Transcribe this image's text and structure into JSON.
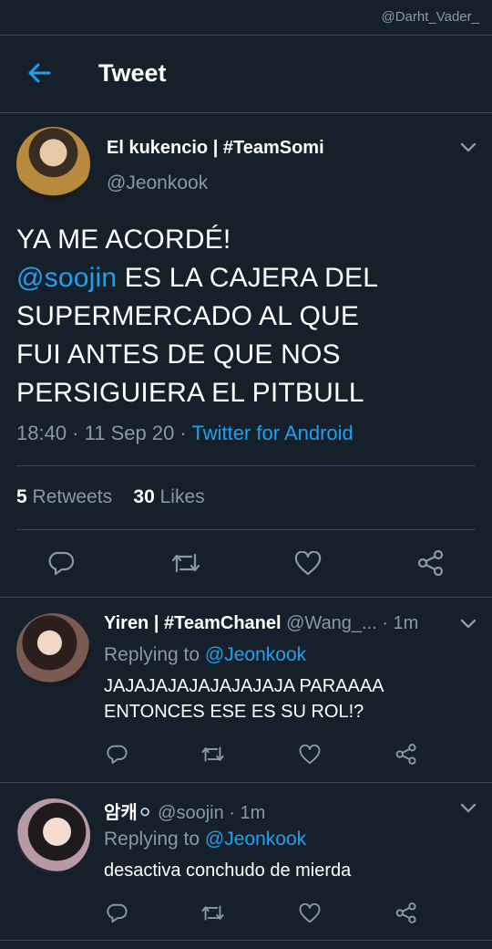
{
  "watermark": "@Darht_Vader_",
  "header": {
    "title": "Tweet"
  },
  "main_tweet": {
    "display_name": "El kukencio | #TeamSomi",
    "handle": "@Jeonkook",
    "text_line1": "YA ME ACORDÉ!",
    "mention": "@soojin",
    "text_rest_line2": " ES LA CAJERA DEL",
    "text_line3": "SUPERMERCADO AL QUE",
    "text_line4": "FUI ANTES DE QUE NOS",
    "text_line5": "PERSIGUIERA EL PITBULL",
    "time": "18:40",
    "date": "11 Sep 20",
    "sep": " · ",
    "source": "Twitter for Android",
    "retweet_count": "5",
    "retweet_label": "Retweets",
    "like_count": "30",
    "like_label": "Likes"
  },
  "replies": [
    {
      "display_name": "Yiren | #TeamChanel",
      "handle": "@Wang_...",
      "time": "· 1m",
      "replying_label": "Replying to",
      "replying_to": "@Jeonkook",
      "text": "JAJAJAJAJAJAJAJAJA PARAAAA ENTONCES ESE ES SU ROL!?"
    },
    {
      "display_name": "암캐",
      "emoji": "⚪",
      "handle": "@soojin",
      "time": "· 1m",
      "replying_label": "Replying to",
      "replying_to": "@Jeonkook",
      "text": "desactiva conchudo de mierda"
    }
  ],
  "icons": {
    "back": "arrow-left-icon",
    "chevron": "chevron-down-icon",
    "reply": "reply-icon",
    "retweet": "retweet-icon",
    "like": "heart-icon",
    "share": "share-icon"
  },
  "colors": {
    "background": "#15202b",
    "accent": "#1da1f2",
    "secondary_text": "#8899a6",
    "divider": "#38444d"
  }
}
